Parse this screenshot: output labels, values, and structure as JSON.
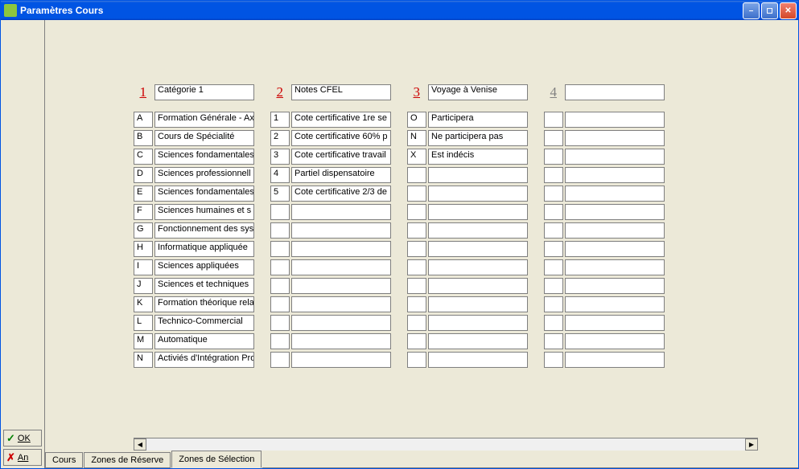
{
  "window": {
    "title": "Paramètres Cours"
  },
  "actions": {
    "ok_label": "OK",
    "cancel_label": "An"
  },
  "tabs": [
    {
      "label": "Cours",
      "active": false
    },
    {
      "label": "Zones de Réserve",
      "active": false
    },
    {
      "label": "Zones de Sélection",
      "active": true
    }
  ],
  "columns": [
    {
      "num": "1",
      "active": true,
      "title": "Catégorie 1",
      "rows": [
        {
          "k": "A",
          "v": "Formation Générale - Axe"
        },
        {
          "k": "B",
          "v": "Cours de Spécialité"
        },
        {
          "k": "C",
          "v": "Sciences fondamentales"
        },
        {
          "k": "D",
          "v": "Sciences professionnell"
        },
        {
          "k": "E",
          "v": "Sciences fondamentales"
        },
        {
          "k": "F",
          "v": "Sciences humaines et s"
        },
        {
          "k": "G",
          "v": "Fonctionnement des sys"
        },
        {
          "k": "H",
          "v": "Informatique appliquée"
        },
        {
          "k": "I",
          "v": "Sciences appliquées"
        },
        {
          "k": "J",
          "v": "Sciences et techniques"
        },
        {
          "k": "K",
          "v": "Formation théorique rela"
        },
        {
          "k": "L",
          "v": "Technico-Commercial"
        },
        {
          "k": "M",
          "v": "Automatique"
        },
        {
          "k": "N",
          "v": "Activiés d'Intégration Pro"
        }
      ]
    },
    {
      "num": "2",
      "active": true,
      "title": "Notes CFEL",
      "rows": [
        {
          "k": "1",
          "v": "Cote certificative 1re se"
        },
        {
          "k": "2",
          "v": "Cote certificative 60% p"
        },
        {
          "k": "3",
          "v": "Cote certificative travail"
        },
        {
          "k": "4",
          "v": "Partiel dispensatoire"
        },
        {
          "k": "5",
          "v": "Cote certificative 2/3 de"
        },
        {
          "k": "",
          "v": ""
        },
        {
          "k": "",
          "v": ""
        },
        {
          "k": "",
          "v": ""
        },
        {
          "k": "",
          "v": ""
        },
        {
          "k": "",
          "v": ""
        },
        {
          "k": "",
          "v": ""
        },
        {
          "k": "",
          "v": ""
        },
        {
          "k": "",
          "v": ""
        },
        {
          "k": "",
          "v": ""
        }
      ]
    },
    {
      "num": "3",
      "active": true,
      "title": "Voyage à Venise",
      "rows": [
        {
          "k": "O",
          "v": "Participera"
        },
        {
          "k": "N",
          "v": "Ne participera pas"
        },
        {
          "k": "X",
          "v": "Est indécis"
        },
        {
          "k": "",
          "v": ""
        },
        {
          "k": "",
          "v": ""
        },
        {
          "k": "",
          "v": ""
        },
        {
          "k": "",
          "v": ""
        },
        {
          "k": "",
          "v": ""
        },
        {
          "k": "",
          "v": ""
        },
        {
          "k": "",
          "v": ""
        },
        {
          "k": "",
          "v": ""
        },
        {
          "k": "",
          "v": ""
        },
        {
          "k": "",
          "v": ""
        },
        {
          "k": "",
          "v": ""
        }
      ]
    },
    {
      "num": "4",
      "active": false,
      "title": "",
      "rows": [
        {
          "k": "",
          "v": ""
        },
        {
          "k": "",
          "v": ""
        },
        {
          "k": "",
          "v": ""
        },
        {
          "k": "",
          "v": ""
        },
        {
          "k": "",
          "v": ""
        },
        {
          "k": "",
          "v": ""
        },
        {
          "k": "",
          "v": ""
        },
        {
          "k": "",
          "v": ""
        },
        {
          "k": "",
          "v": ""
        },
        {
          "k": "",
          "v": ""
        },
        {
          "k": "",
          "v": ""
        },
        {
          "k": "",
          "v": ""
        },
        {
          "k": "",
          "v": ""
        },
        {
          "k": "",
          "v": ""
        }
      ]
    }
  ]
}
